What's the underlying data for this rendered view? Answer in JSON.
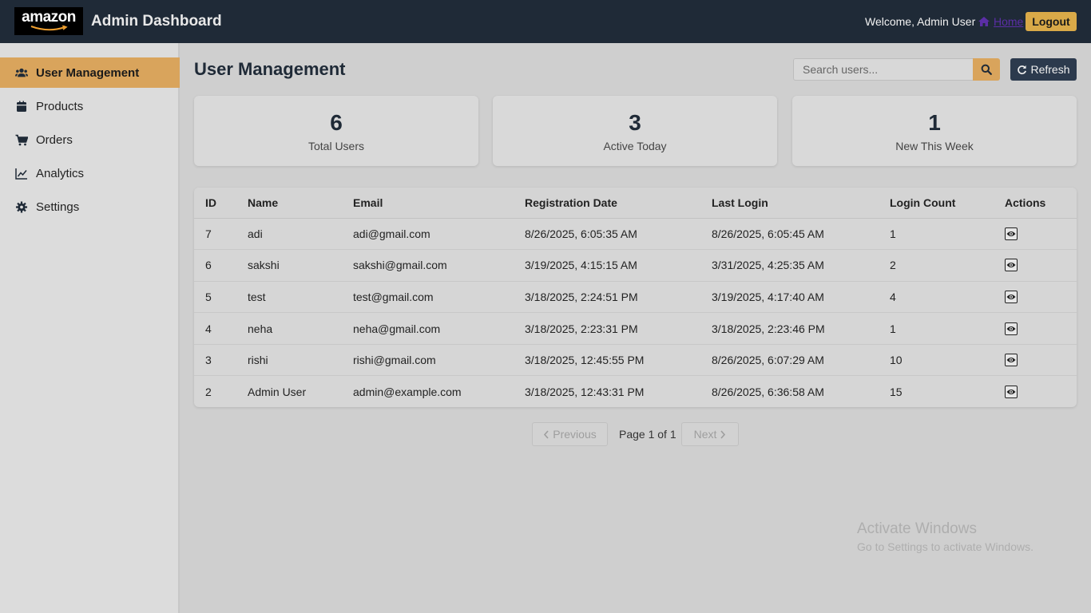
{
  "header": {
    "logo_text": "amazon",
    "title": "Admin Dashboard",
    "welcome": "Welcome, Admin User",
    "home_label": "Home",
    "logout_label": "Logout"
  },
  "sidebar": {
    "items": [
      {
        "label": "User Management",
        "icon": "users-icon",
        "active": true
      },
      {
        "label": "Products",
        "icon": "box-icon"
      },
      {
        "label": "Orders",
        "icon": "cart-icon"
      },
      {
        "label": "Analytics",
        "icon": "chart-line-icon"
      },
      {
        "label": "Settings",
        "icon": "gear-icon"
      }
    ]
  },
  "main": {
    "title": "User Management",
    "search_placeholder": "Search users...",
    "refresh_label": "Refresh",
    "stats": [
      {
        "value": "6",
        "label": "Total Users"
      },
      {
        "value": "3",
        "label": "Active Today"
      },
      {
        "value": "1",
        "label": "New This Week"
      }
    ],
    "table": {
      "columns": [
        "ID",
        "Name",
        "Email",
        "Registration Date",
        "Last Login",
        "Login Count",
        "Actions"
      ],
      "rows": [
        {
          "id": "7",
          "name": "adi",
          "email": "adi@gmail.com",
          "registered": "8/26/2025, 6:05:35 AM",
          "last_login": "8/26/2025, 6:05:45 AM",
          "login_count": "1"
        },
        {
          "id": "6",
          "name": "sakshi",
          "email": "sakshi@gmail.com",
          "registered": "3/19/2025, 4:15:15 AM",
          "last_login": "3/31/2025, 4:25:35 AM",
          "login_count": "2"
        },
        {
          "id": "5",
          "name": "test",
          "email": "test@gmail.com",
          "registered": "3/18/2025, 2:24:51 PM",
          "last_login": "3/19/2025, 4:17:40 AM",
          "login_count": "4"
        },
        {
          "id": "4",
          "name": "neha",
          "email": "neha@gmail.com",
          "registered": "3/18/2025, 2:23:31 PM",
          "last_login": "3/18/2025, 2:23:46 PM",
          "login_count": "1"
        },
        {
          "id": "3",
          "name": "rishi",
          "email": "rishi@gmail.com",
          "registered": "3/18/2025, 12:45:55 PM",
          "last_login": "8/26/2025, 6:07:29 AM",
          "login_count": "10"
        },
        {
          "id": "2",
          "name": "Admin User",
          "email": "admin@example.com",
          "registered": "3/18/2025, 12:43:31 PM",
          "last_login": "8/26/2025, 6:36:58 AM",
          "login_count": "15"
        }
      ]
    },
    "pagination": {
      "previous_label": "Previous",
      "page_info": "Page 1 of 1",
      "next_label": "Next"
    }
  },
  "watermark": {
    "title": "Activate Windows",
    "subtitle": "Go to Settings to activate Windows."
  },
  "colors": {
    "header_bg": "#1f2a37",
    "accent": "#d9a45c",
    "logout_bg": "#d9a948",
    "refresh_bg": "#2c3a4d"
  }
}
